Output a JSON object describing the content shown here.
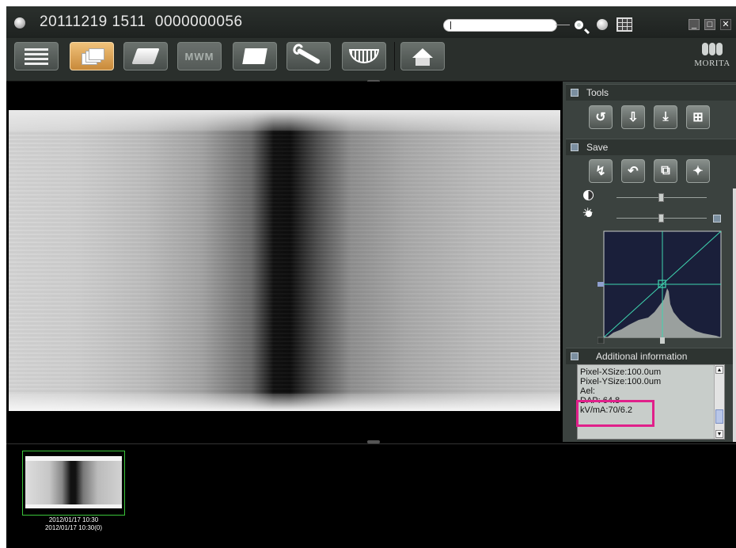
{
  "titlebar": {
    "title": "20111219 1511  0000000056",
    "search": {
      "value": "",
      "placeholder": ""
    },
    "icons": [
      "search-icon",
      "patient-icon",
      "grid-icon"
    ],
    "window_controls": [
      "minimize",
      "maximize",
      "close"
    ]
  },
  "toolbar": {
    "buttons": [
      {
        "name": "list-view",
        "icon": "list-icon"
      },
      {
        "name": "stack-view",
        "icon": "stack-icon",
        "active": true
      },
      {
        "name": "print",
        "icon": "printer-icon"
      },
      {
        "name": "mwm",
        "label": "MWM"
      },
      {
        "name": "notes",
        "icon": "note-icon"
      },
      {
        "name": "tools",
        "icon": "wrench-icon"
      },
      {
        "name": "panoramic",
        "icon": "teeth-icon"
      },
      {
        "name": "home",
        "icon": "home-icon"
      }
    ],
    "logo_text": "MORITA"
  },
  "panel": {
    "tools_title": "Tools",
    "tools_icons": [
      "rotate-icon",
      "save-down-icon",
      "export-icon",
      "measure-icon"
    ],
    "save_title": "Save",
    "save_icons": [
      "save-image-icon",
      "undo-save-icon",
      "copy-save-icon",
      "import-icon"
    ],
    "contrast_level": 0.5,
    "brightness_level": 0.5,
    "additional_title": "Additional information",
    "info_lines": [
      "Pixel-XSize:100.0um",
      "Pixel-YSize:100.0um",
      "Ael:",
      "DAP: 64.8",
      "kV/mA:70/6.2"
    ]
  },
  "thumbnail": {
    "caption_line1": "2012/01/17 10:30",
    "caption_line2": "2012/01/17 10:30(0)"
  },
  "colors": {
    "highlight": "#e0208a",
    "curve": "#3fd6b0",
    "thumb_border": "#3ac43a",
    "active_button": "#e8a95a"
  }
}
